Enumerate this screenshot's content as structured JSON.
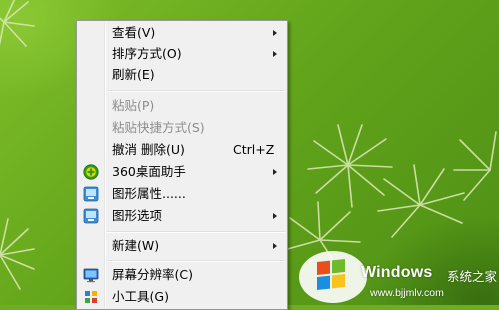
{
  "context_menu": {
    "items": [
      {
        "label": "查看(V)",
        "submenu": true
      },
      {
        "label": "排序方式(O)",
        "submenu": true
      },
      {
        "label": "刷新(E)"
      },
      {
        "label": "粘贴(P)",
        "disabled": true
      },
      {
        "label": "粘贴快捷方式(S)",
        "disabled": true
      },
      {
        "label": "撤消 删除(U)",
        "shortcut": "Ctrl+Z"
      },
      {
        "label": "360桌面助手",
        "submenu": true,
        "icon": "360-icon"
      },
      {
        "label": "图形属性......",
        "icon": "graphics-properties-icon"
      },
      {
        "label": "图形选项",
        "submenu": true,
        "icon": "graphics-options-icon"
      },
      {
        "label": "新建(W)",
        "submenu": true
      },
      {
        "label": "屏幕分辨率(C)",
        "icon": "screen-resolution-icon"
      },
      {
        "label": "小工具(G)",
        "icon": "gadgets-icon"
      }
    ]
  },
  "watermark": {
    "brand": "Windows",
    "subtitle": "系统之家",
    "url": "www.bjjmlv.com"
  },
  "colors": {
    "menu_bg": "#f0f0f0",
    "menu_border": "#979797",
    "disabled_text": "#8d8d8d",
    "desktop_green": "#6cae1e"
  }
}
